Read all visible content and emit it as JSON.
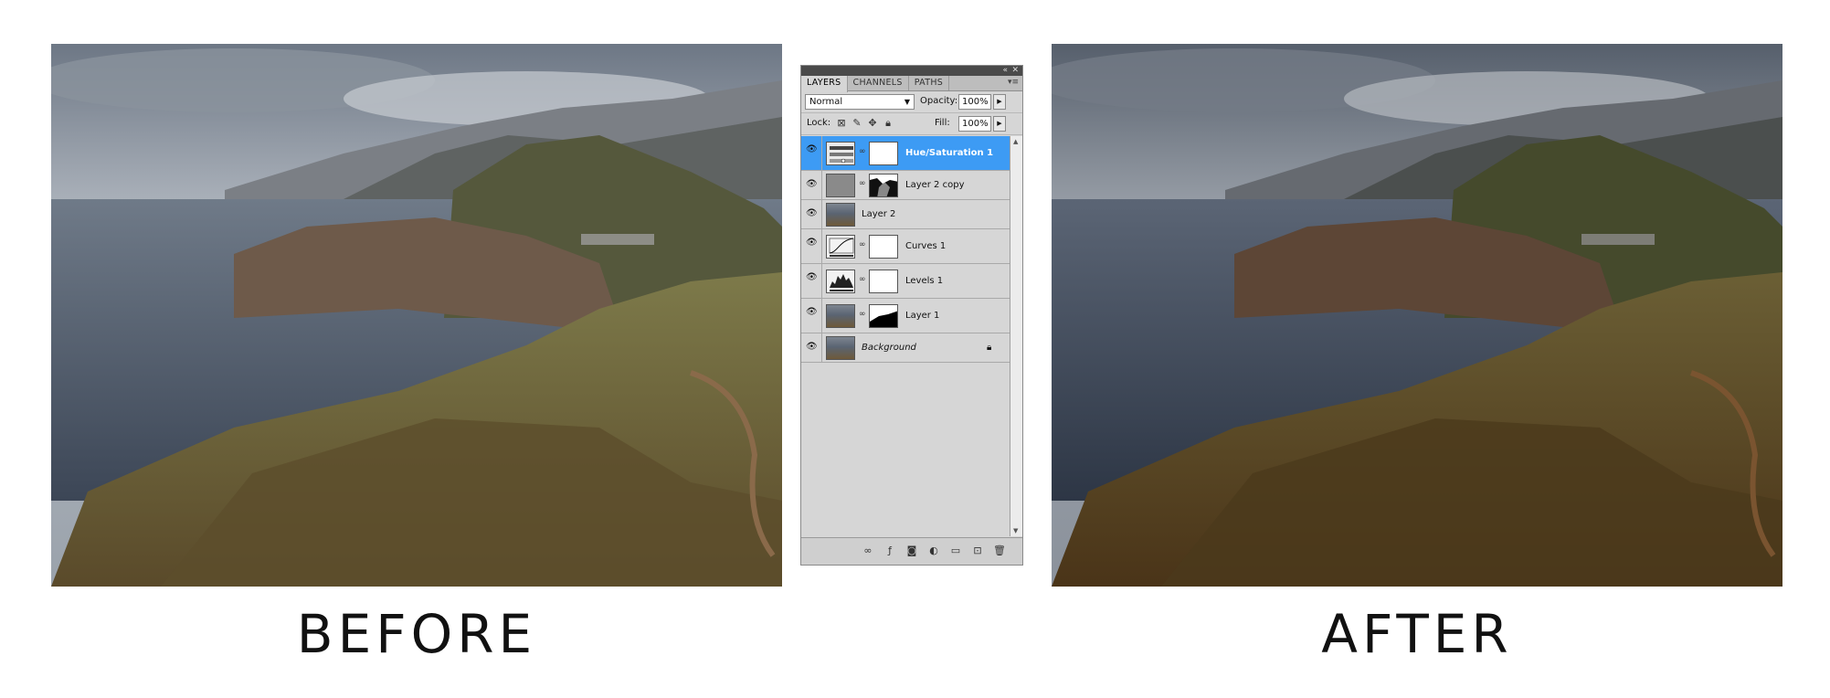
{
  "captions": {
    "before": "BEFORE",
    "after": "AFTER"
  },
  "panel": {
    "tabs": [
      "LAYERS",
      "CHANNELS",
      "PATHS"
    ],
    "blend_mode": "Normal",
    "opacity_label": "Opacity:",
    "opacity_value": "100%",
    "lock_label": "Lock:",
    "fill_label": "Fill:",
    "fill_value": "100%",
    "layers": [
      {
        "name": "Hue/Saturation 1",
        "selected": true
      },
      {
        "name": "Layer 2 copy"
      },
      {
        "name": "Layer 2"
      },
      {
        "name": "Curves 1"
      },
      {
        "name": "Levels 1"
      },
      {
        "name": "Layer 1"
      },
      {
        "name": "Background"
      }
    ]
  },
  "colors": {
    "selection": "#3d9bf4",
    "panel_bg": "#d6d6d6"
  }
}
